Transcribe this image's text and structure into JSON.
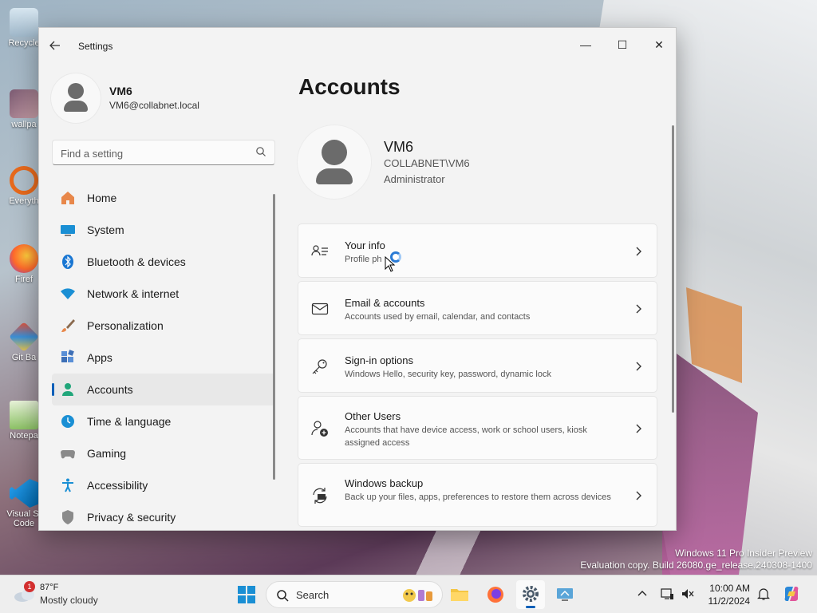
{
  "desktop": {
    "icons": [
      {
        "label": "Recycle"
      },
      {
        "label": "wallpa"
      },
      {
        "label": "Everyth"
      },
      {
        "label": "Firef"
      },
      {
        "label": "Git Ba"
      },
      {
        "label": "Notepa"
      },
      {
        "label": "Visual St Code"
      }
    ],
    "watermark": {
      "line1": "Windows 11 Pro Insider Preview",
      "line2": "Evaluation copy. Build 26080.ge_release.240308-1400"
    }
  },
  "window": {
    "title": "Settings",
    "controls": {
      "minimize": "—",
      "maximize": "☐",
      "close": "✕"
    }
  },
  "sidebar": {
    "profile": {
      "name": "VM6",
      "email": "VM6@collabnet.local"
    },
    "search_placeholder": "Find a setting",
    "items": [
      {
        "label": "Home"
      },
      {
        "label": "System"
      },
      {
        "label": "Bluetooth & devices"
      },
      {
        "label": "Network & internet"
      },
      {
        "label": "Personalization"
      },
      {
        "label": "Apps"
      },
      {
        "label": "Accounts",
        "active": true
      },
      {
        "label": "Time & language"
      },
      {
        "label": "Gaming"
      },
      {
        "label": "Accessibility"
      },
      {
        "label": "Privacy & security"
      }
    ]
  },
  "main": {
    "title": "Accounts",
    "account": {
      "name": "VM6",
      "domain": "COLLABNET\\VM6",
      "role": "Administrator"
    },
    "cards": [
      {
        "title": "Your info",
        "subtitle": "Profile ph"
      },
      {
        "title": "Email & accounts",
        "subtitle": "Accounts used by email, calendar, and contacts"
      },
      {
        "title": "Sign-in options",
        "subtitle": "Windows Hello, security key, password, dynamic lock"
      },
      {
        "title": "Other Users",
        "subtitle": "Accounts that have device access, work or school users, kiosk assigned access"
      },
      {
        "title": "Windows backup",
        "subtitle": "Back up your files, apps, preferences to restore them across devices"
      }
    ]
  },
  "taskbar": {
    "weather": {
      "badge": "1",
      "temp": "87°F",
      "condition": "Mostly cloudy"
    },
    "search_label": "Search",
    "clock": {
      "time": "10:00 AM",
      "date": "11/2/2024"
    }
  },
  "colors": {
    "accent": "#005fb8",
    "window_bg": "#f3f3f3",
    "card_bg": "#fbfbfb"
  }
}
